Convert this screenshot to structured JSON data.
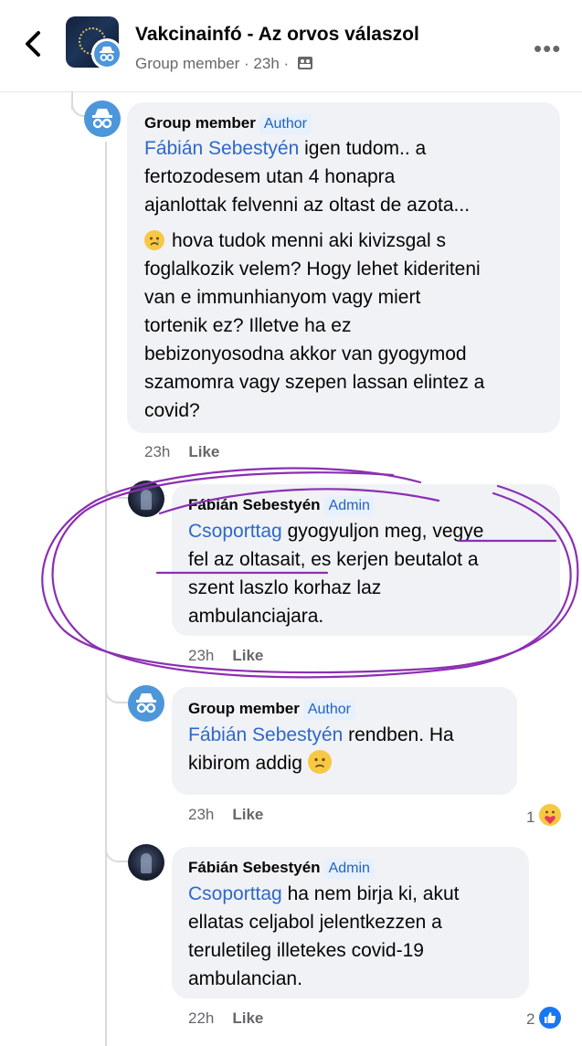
{
  "header": {
    "title": "Vakcinainfó - Az orvos válaszol",
    "subtitle": "Group member · 23h ·",
    "back_icon": "chevron-left-icon",
    "more_icon": "more-icon",
    "more_label": "•••"
  },
  "comments": [
    {
      "author": "Group member",
      "badge": "Author",
      "mention": "Fábián Sebestyén",
      "line1_rest": " igen tudom.. a",
      "lines": [
        "fertozodesem utan 4 honapra",
        "ajanlottak felvenni az oltast de azota..."
      ],
      "para2": [
        "hova tudok menni aki kivizsgal s",
        "foglalkozik velem? Hogy lehet kideriteni",
        "van e immunhianyom vagy miert",
        "tortenik ez? Illetve ha ez",
        "bebizonyosodna akkor van gyogymod",
        "szamomra vagy szepen lassan elintez a",
        "covid?"
      ],
      "time": "23h",
      "like": "Like"
    },
    {
      "author": "Fábián Sebestyén",
      "badge": "Admin",
      "mention": "Csoporttag",
      "line1_rest": " gyogyuljon meg, vegye",
      "lines": [
        "fel az oltasait, es kerjen beutalot a",
        "szent laszlo korhaz laz",
        "ambulanciajara."
      ],
      "time": "23h",
      "like": "Like"
    },
    {
      "author": "Group member",
      "badge": "Author",
      "mention": "Fábián Sebestyén",
      "line1_rest": " rendben. Ha",
      "lines": [
        "kibirom addig"
      ],
      "time": "23h",
      "like": "Like",
      "reaction_count": "1"
    },
    {
      "author": "Fábián Sebestyén",
      "badge": "Admin",
      "mention": "Csoporttag",
      "line1_rest": " ha nem birja ki, akut",
      "lines": [
        "ellatas celjabol jelentkezzen a",
        "teruletileg illetekes covid-19",
        "ambulancian."
      ],
      "time": "22h",
      "like": "Like",
      "reaction_count": "2"
    }
  ],
  "colors": {
    "mention": "#2e68c8",
    "badge_text": "#2163c2",
    "badge_bg": "#e7f0fd",
    "bubble": "#f0f2f5",
    "scribble": "#8b2fb3"
  }
}
